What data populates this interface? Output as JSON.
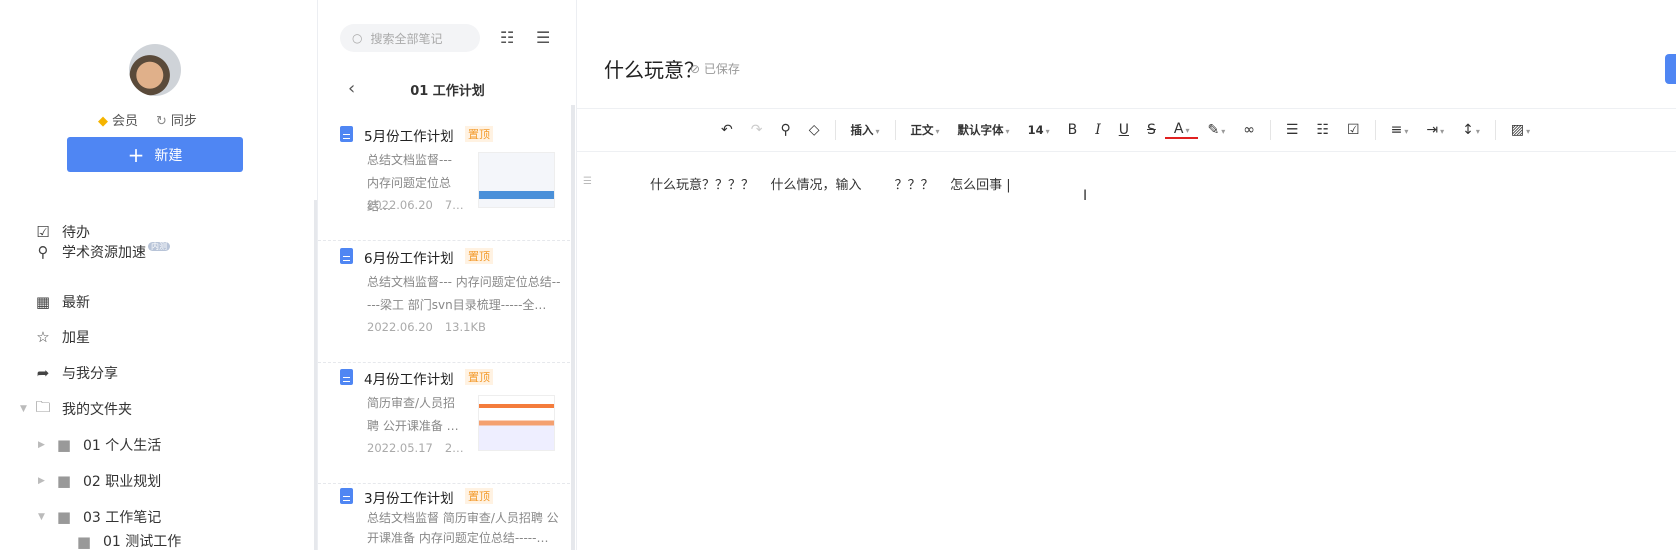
{
  "sidebar": {
    "member": "会员",
    "sync": "同步",
    "new_button": "新建",
    "items": [
      {
        "label": "待办",
        "icon": "checkbox-icon"
      },
      {
        "label": "学术资源加速",
        "badge": "内测",
        "icon": "rocket-icon"
      },
      {
        "label": "最新",
        "icon": "grid-icon"
      },
      {
        "label": "加星",
        "icon": "star-icon"
      },
      {
        "label": "与我分享",
        "icon": "share-icon"
      },
      {
        "label": "我的文件夹",
        "icon": "folder-icon"
      }
    ],
    "folders": [
      {
        "label": "01 个人生活"
      },
      {
        "label": "02 职业规划"
      },
      {
        "label": "03 工作笔记"
      },
      {
        "label": "01 测试工作"
      }
    ]
  },
  "list": {
    "search_placeholder": "搜索全部笔记",
    "folder_title": "01 工作计划",
    "pin_label": "置顶",
    "notes": [
      {
        "title": "5月份工作计划",
        "summary": "总结文档监督--- 内存问题定位总结…",
        "date": "2022.06.20",
        "size": "7…"
      },
      {
        "title": "6月份工作计划",
        "summary": "总结文档监督--- 内存问题定位总结-----梁工 部门svn目录梳理-----全…",
        "date": "2022.06.20",
        "size": "13.1KB"
      },
      {
        "title": "4月份工作计划",
        "summary": "简历审查/人员招聘 公开课准备 …",
        "date": "2022.05.17",
        "size": "2…"
      },
      {
        "title": "3月份工作计划",
        "summary": "总结文档监督 简历审查/人员招聘 公开课准备 内存问题定位总结-----…"
      }
    ]
  },
  "editor": {
    "title": "什么玩意？",
    "status": "已保存",
    "toolbar": {
      "insert": "插入",
      "style": "正文",
      "font": "默认字体",
      "size": "14",
      "bold": "B",
      "italic": "I",
      "underline": "U",
      "strike": "S",
      "color": "A"
    },
    "content": "什么玩意？？？？    什么情况，输入        ？？？    怎么回事 |",
    "accent": "#4f86f3"
  }
}
